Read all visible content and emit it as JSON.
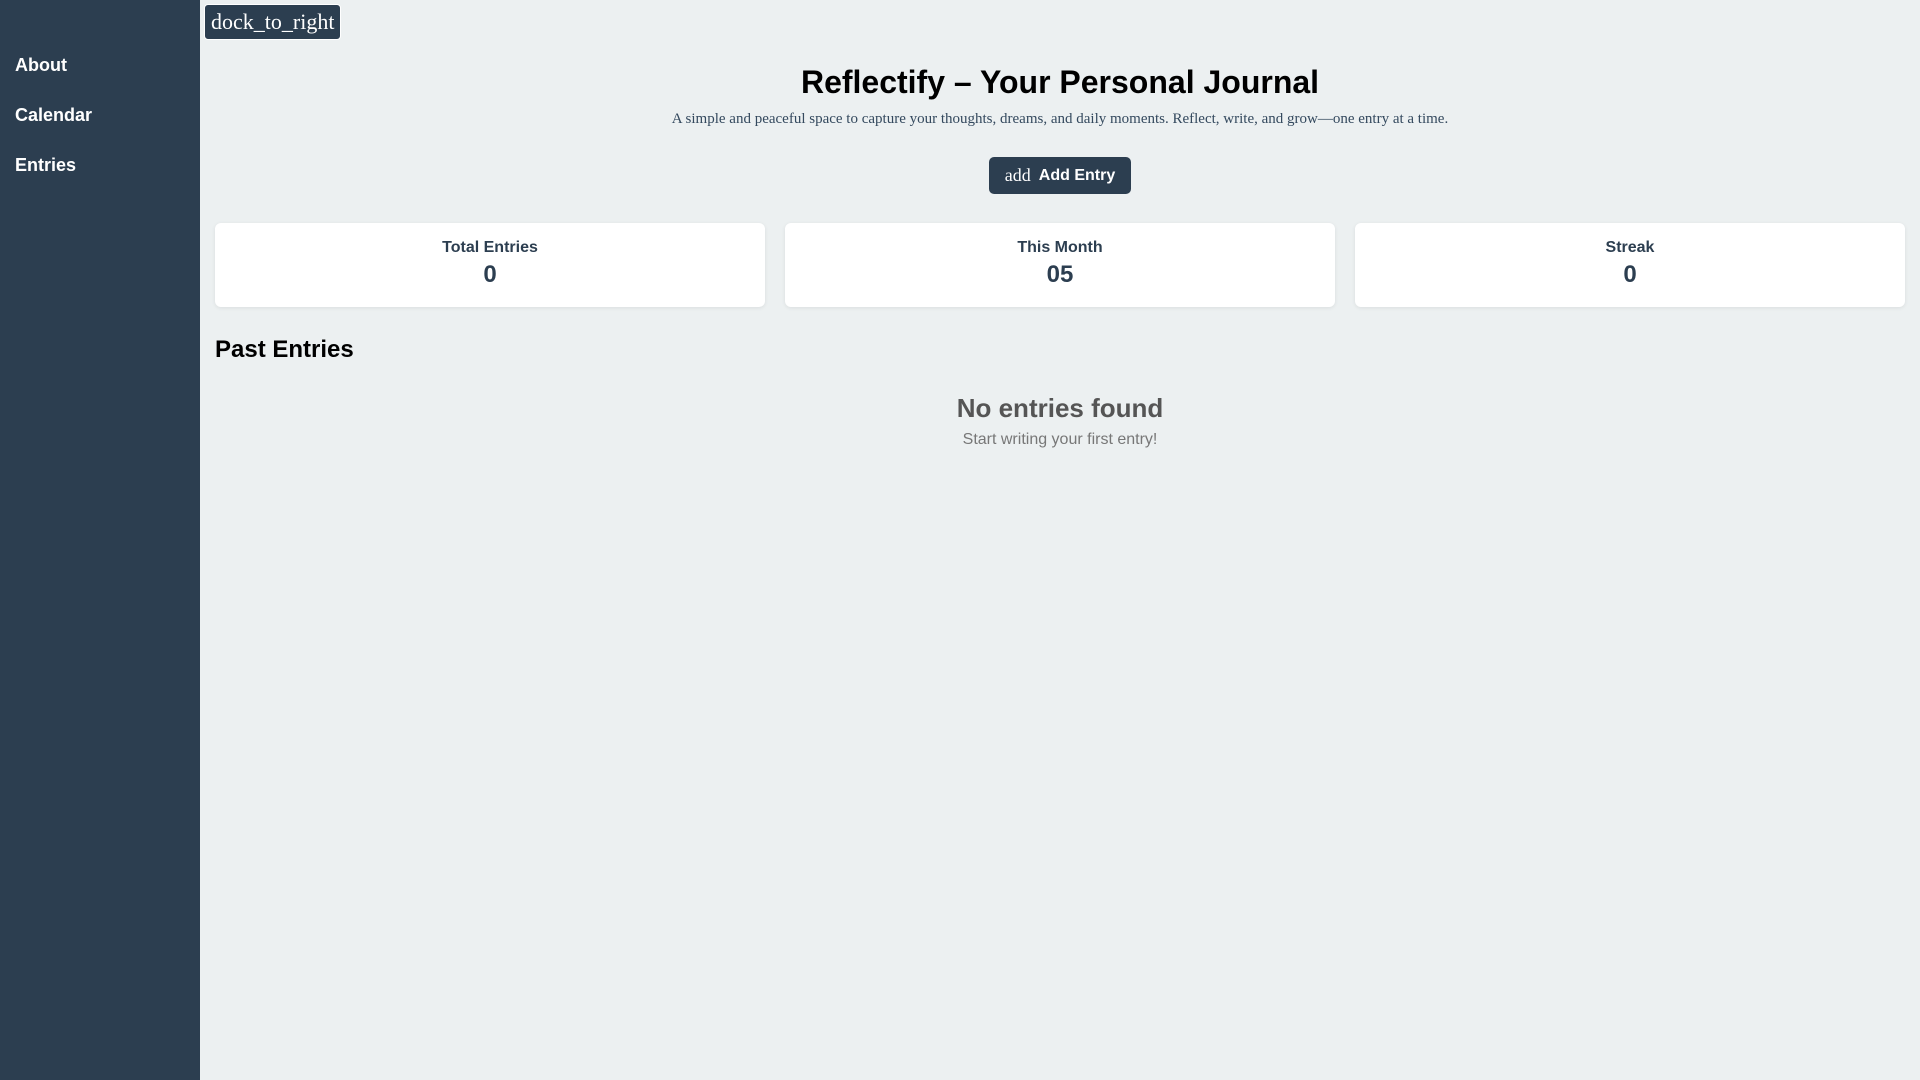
{
  "sidebar": {
    "items": [
      {
        "label": "About"
      },
      {
        "label": "Calendar"
      },
      {
        "label": "Entries"
      }
    ],
    "toggle_label": "dock_to_right"
  },
  "header": {
    "title": "Reflectify – Your Personal Journal",
    "subtitle": "A simple and peaceful space to capture your thoughts, dreams, and daily moments. Reflect, write, and grow—one entry at a time."
  },
  "add_button": {
    "icon_text": "add",
    "label": "Add Entry"
  },
  "stats": [
    {
      "label": "Total Entries",
      "value": "0"
    },
    {
      "label": "This Month",
      "value": "05"
    },
    {
      "label": "Streak",
      "value": "0"
    }
  ],
  "past_entries": {
    "heading": "Past Entries",
    "empty_title": "No entries found",
    "empty_subtitle": "Start writing your first entry!"
  },
  "colors": {
    "sidebar_bg": "#2c3e50",
    "page_bg": "#ecf0f1",
    "card_bg": "#ffffff",
    "accent": "#2c3e50"
  }
}
